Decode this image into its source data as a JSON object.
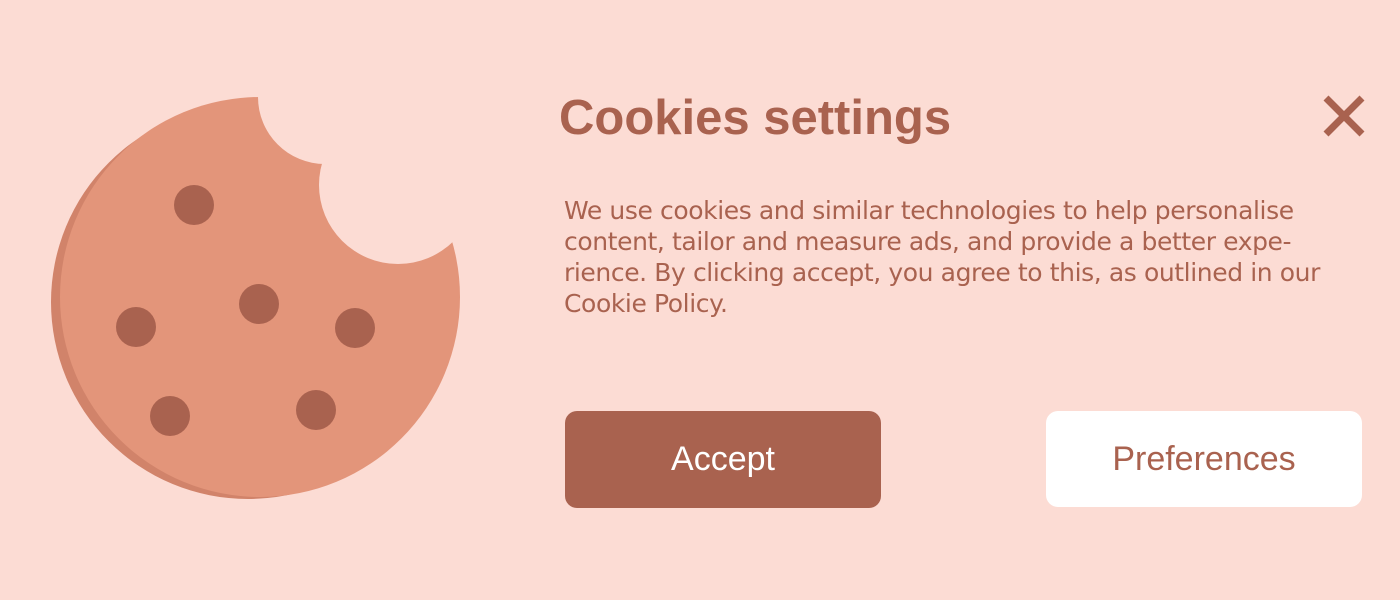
{
  "colors": {
    "background": "#fcdcd4",
    "accent": "#a9624f",
    "cookie": "#e3957a",
    "cookie_shadow": "#d1836a",
    "chip": "#a9624f",
    "button_text_light": "#ffffff",
    "button_light": "#ffffff"
  },
  "icons": {
    "illustration": "bitten-cookie-icon",
    "close": "close-icon"
  },
  "dialog": {
    "title": "Cookies settings",
    "body": "We use cookies and similar technologies to help personalise\ncontent, tailor and measure ads, and provide a better expe-\nrience. By clicking accept, you agree to this, as outlined in our\nCookie Policy.",
    "accept_label": "Accept",
    "preferences_label": "Preferences"
  }
}
